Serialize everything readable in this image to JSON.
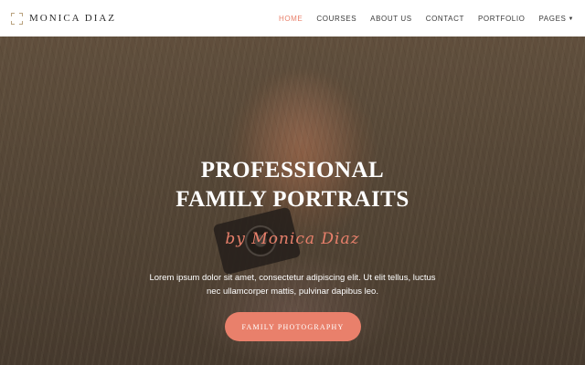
{
  "header": {
    "brand": "MONICA DIAZ",
    "nav": [
      {
        "label": "HOME",
        "active": true
      },
      {
        "label": "COURSES",
        "active": false
      },
      {
        "label": "ABOUT US",
        "active": false
      },
      {
        "label": "CONTACT",
        "active": false
      },
      {
        "label": "PORTFOLIO",
        "active": false
      },
      {
        "label": "PAGES",
        "active": false,
        "dropdown": true
      }
    ]
  },
  "hero": {
    "title_line1": "PROFESSIONAL",
    "title_line2": "FAMILY PORTRAITS",
    "signature": "by Monica Diaz",
    "text_line1": "Lorem ipsum dolor sit amet, consectetur adipiscing elit. Ut elit tellus, luctus",
    "text_line2": "nec ullamcorper mattis, pulvinar dapibus leo.",
    "cta_label": "FAMILY PHOTOGRAPHY"
  },
  "icons": {
    "logo": "corner-frame-icon",
    "dropdown": "chevron-down-icon"
  },
  "colors": {
    "accent": "#e9806b",
    "brand_text": "#2b2b2b",
    "header_bg": "#ffffff"
  }
}
